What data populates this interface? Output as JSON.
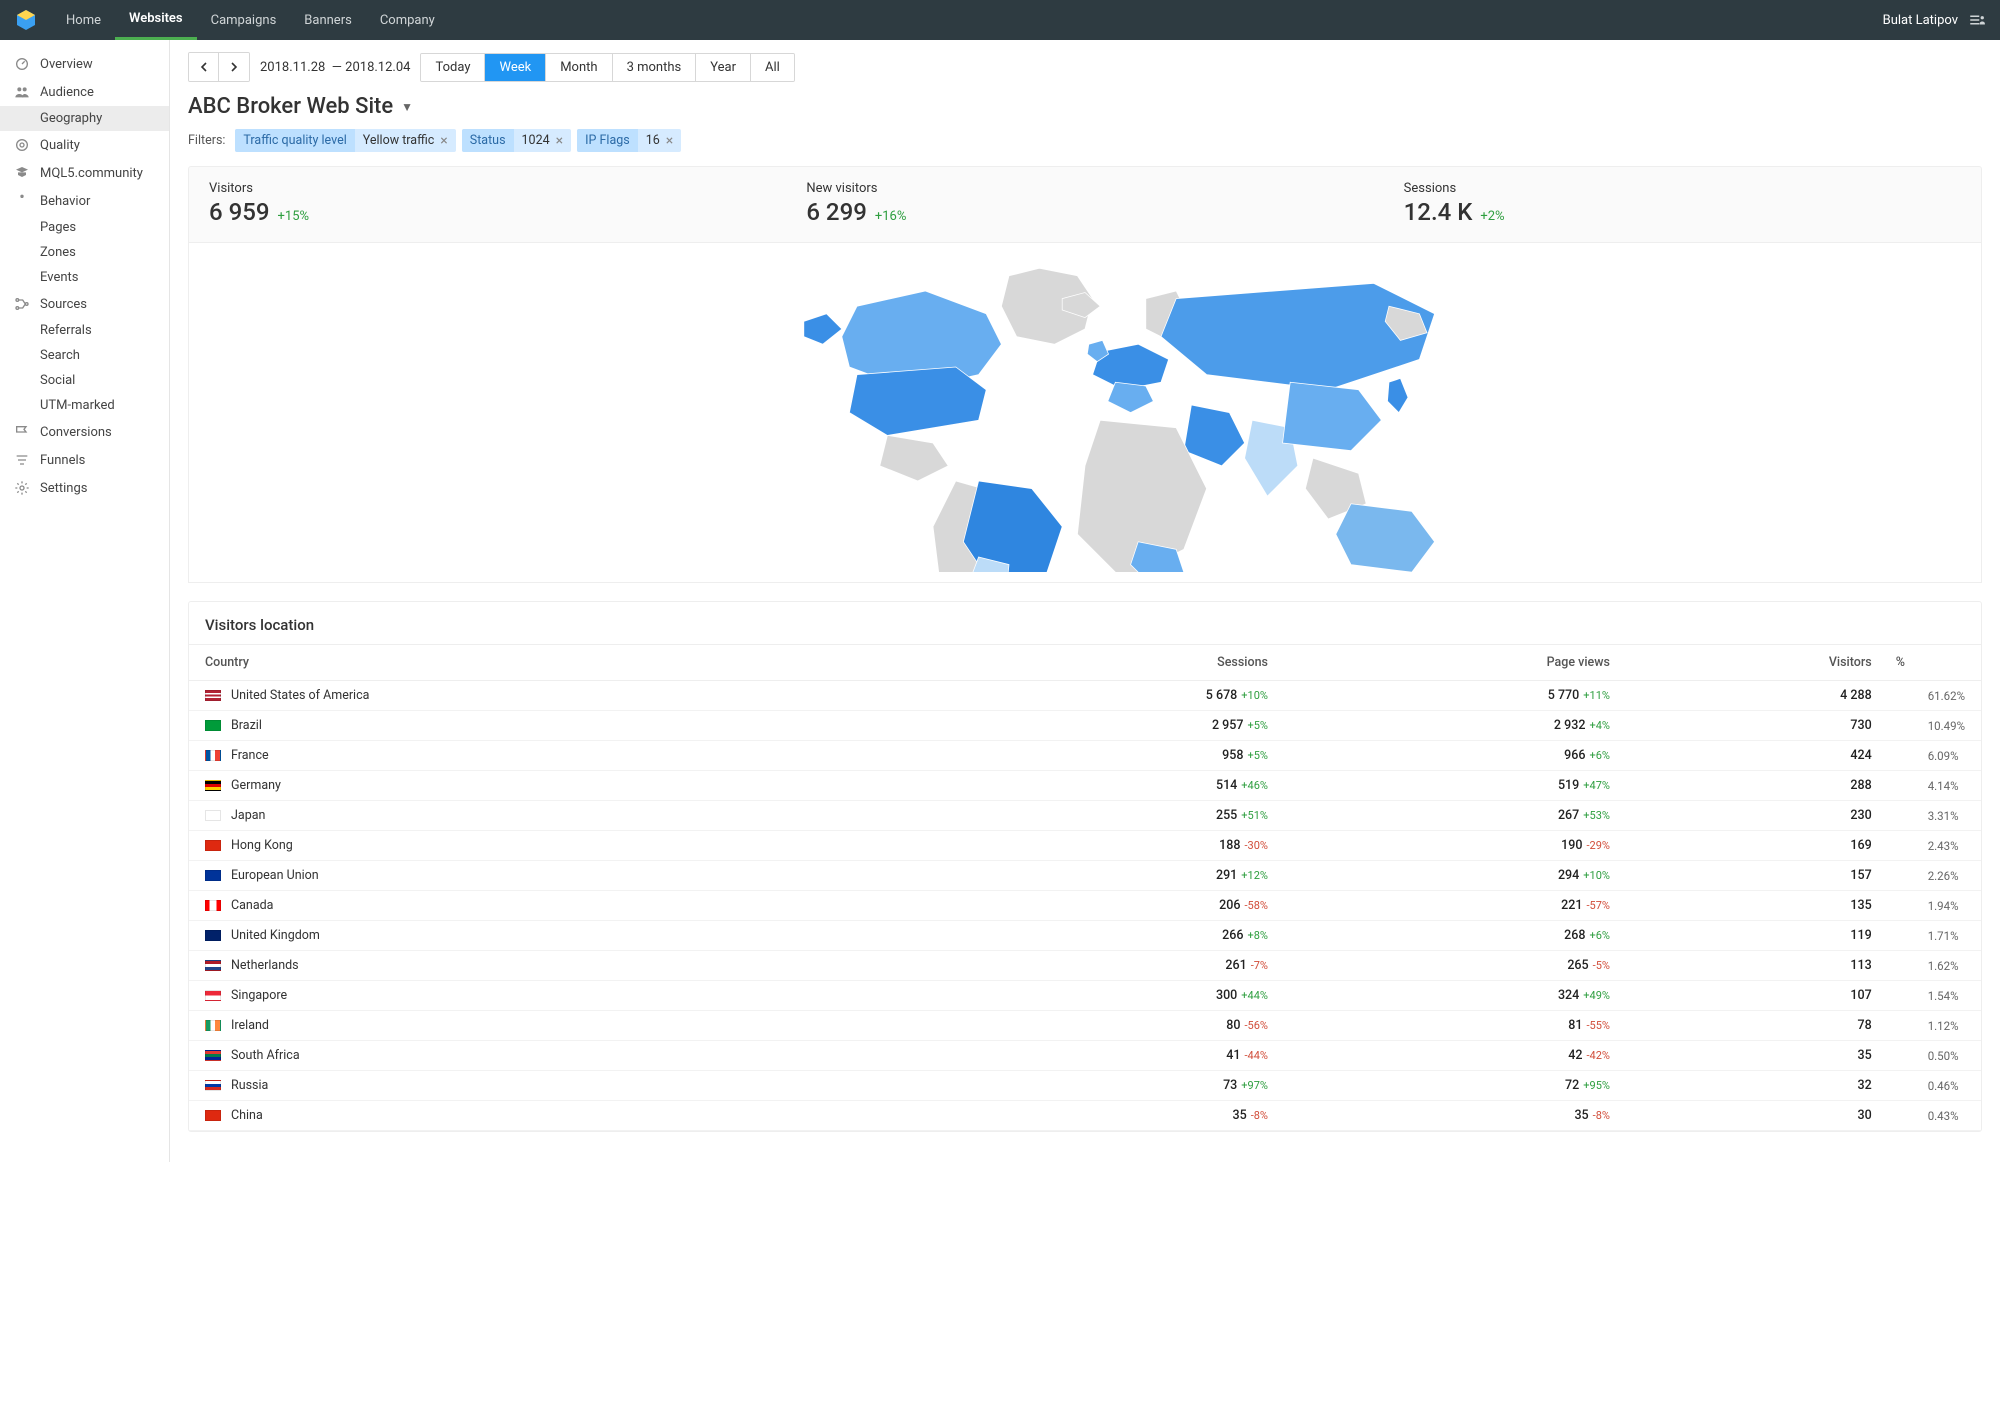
{
  "nav": {
    "items": [
      "Home",
      "Websites",
      "Campaigns",
      "Banners",
      "Company"
    ],
    "active": 1,
    "user": "Bulat Latipov"
  },
  "sidebar": {
    "items": [
      {
        "label": "Overview",
        "icon": "overview"
      },
      {
        "label": "Audience",
        "icon": "audience",
        "subs": [
          {
            "label": "Geography",
            "active": true
          }
        ]
      },
      {
        "label": "Quality",
        "icon": "quality"
      },
      {
        "label": "MQL5.community",
        "icon": "community"
      },
      {
        "label": "Behavior",
        "icon": "behavior",
        "subs": [
          {
            "label": "Pages"
          },
          {
            "label": "Zones"
          },
          {
            "label": "Events"
          }
        ]
      },
      {
        "label": "Sources",
        "icon": "sources",
        "subs": [
          {
            "label": "Referrals"
          },
          {
            "label": "Search"
          },
          {
            "label": "Social"
          },
          {
            "label": "UTM-marked"
          }
        ]
      },
      {
        "label": "Conversions",
        "icon": "conversions"
      },
      {
        "label": "Funnels",
        "icon": "funnels"
      },
      {
        "label": "Settings",
        "icon": "settings"
      }
    ]
  },
  "toolbar": {
    "date_from": "2018.11.28",
    "date_to": "2018.12.04",
    "separator": "—",
    "ranges": [
      "Today",
      "Week",
      "Month",
      "3 months",
      "Year",
      "All"
    ],
    "active_range": 1
  },
  "page": {
    "title": "ABC Broker Web Site"
  },
  "filters": {
    "label": "Filters:",
    "chips": [
      {
        "key": "Traffic quality level",
        "val": "Yellow traffic",
        "closable": true
      },
      {
        "key": "Status",
        "val": "1024",
        "closable": true
      },
      {
        "key": "IP Flags",
        "val": "16",
        "closable": true
      }
    ]
  },
  "stats": [
    {
      "label": "Visitors",
      "value": "6 959",
      "delta": "+15%",
      "dir": "pos"
    },
    {
      "label": "New visitors",
      "value": "6 299",
      "delta": "+16%",
      "dir": "pos"
    },
    {
      "label": "Sessions",
      "value": "12.4 K",
      "delta": "+2%",
      "dir": "pos"
    }
  ],
  "table": {
    "title": "Visitors location",
    "columns": [
      "Country",
      "Sessions",
      "Page views",
      "Visitors",
      "%"
    ],
    "rows": [
      {
        "flag": "us",
        "country": "United States of America",
        "sessions": "5 678",
        "sessions_d": "+10%",
        "sd": "pos",
        "views": "5 770",
        "views_d": "+11%",
        "vd": "pos",
        "visitors": "4 288",
        "pct": "61.62%",
        "bar": 61.62
      },
      {
        "flag": "br",
        "country": "Brazil",
        "sessions": "2 957",
        "sessions_d": "+5%",
        "sd": "pos",
        "views": "2 932",
        "views_d": "+4%",
        "vd": "pos",
        "visitors": "730",
        "pct": "10.49%",
        "bar": 10.49
      },
      {
        "flag": "fr",
        "country": "France",
        "sessions": "958",
        "sessions_d": "+5%",
        "sd": "pos",
        "views": "966",
        "views_d": "+6%",
        "vd": "pos",
        "visitors": "424",
        "pct": "6.09%",
        "bar": 6.09
      },
      {
        "flag": "de",
        "country": "Germany",
        "sessions": "514",
        "sessions_d": "+46%",
        "sd": "pos",
        "views": "519",
        "views_d": "+47%",
        "vd": "pos",
        "visitors": "288",
        "pct": "4.14%",
        "bar": 4.14
      },
      {
        "flag": "jp",
        "country": "Japan",
        "sessions": "255",
        "sessions_d": "+51%",
        "sd": "pos",
        "views": "267",
        "views_d": "+53%",
        "vd": "pos",
        "visitors": "230",
        "pct": "3.31%",
        "bar": 3.31
      },
      {
        "flag": "hk",
        "country": "Hong Kong",
        "sessions": "188",
        "sessions_d": "-30%",
        "sd": "neg",
        "views": "190",
        "views_d": "-29%",
        "vd": "neg",
        "visitors": "169",
        "pct": "2.43%",
        "bar": 2.43
      },
      {
        "flag": "eu",
        "country": "European Union",
        "sessions": "291",
        "sessions_d": "+12%",
        "sd": "pos",
        "views": "294",
        "views_d": "+10%",
        "vd": "pos",
        "visitors": "157",
        "pct": "2.26%",
        "bar": 2.26
      },
      {
        "flag": "ca",
        "country": "Canada",
        "sessions": "206",
        "sessions_d": "-58%",
        "sd": "neg",
        "views": "221",
        "views_d": "-57%",
        "vd": "neg",
        "visitors": "135",
        "pct": "1.94%",
        "bar": 1.94
      },
      {
        "flag": "gb",
        "country": "United Kingdom",
        "sessions": "266",
        "sessions_d": "+8%",
        "sd": "pos",
        "views": "268",
        "views_d": "+6%",
        "vd": "pos",
        "visitors": "119",
        "pct": "1.71%",
        "bar": 1.71
      },
      {
        "flag": "nl",
        "country": "Netherlands",
        "sessions": "261",
        "sessions_d": "-7%",
        "sd": "neg",
        "views": "265",
        "views_d": "-5%",
        "vd": "neg",
        "visitors": "113",
        "pct": "1.62%",
        "bar": 1.62
      },
      {
        "flag": "sg",
        "country": "Singapore",
        "sessions": "300",
        "sessions_d": "+44%",
        "sd": "pos",
        "views": "324",
        "views_d": "+49%",
        "vd": "pos",
        "visitors": "107",
        "pct": "1.54%",
        "bar": 1.54
      },
      {
        "flag": "ie",
        "country": "Ireland",
        "sessions": "80",
        "sessions_d": "-56%",
        "sd": "neg",
        "views": "81",
        "views_d": "-55%",
        "vd": "neg",
        "visitors": "78",
        "pct": "1.12%",
        "bar": 1.12
      },
      {
        "flag": "za",
        "country": "South Africa",
        "sessions": "41",
        "sessions_d": "-44%",
        "sd": "neg",
        "views": "42",
        "views_d": "-42%",
        "vd": "neg",
        "visitors": "35",
        "pct": "0.50%",
        "bar": 0.5
      },
      {
        "flag": "ru",
        "country": "Russia",
        "sessions": "73",
        "sessions_d": "+97%",
        "sd": "pos",
        "views": "72",
        "views_d": "+95%",
        "vd": "pos",
        "visitors": "32",
        "pct": "0.46%",
        "bar": 0.46
      },
      {
        "flag": "cn",
        "country": "China",
        "sessions": "35",
        "sessions_d": "-8%",
        "sd": "neg",
        "views": "35",
        "views_d": "-8%",
        "vd": "neg",
        "visitors": "30",
        "pct": "0.43%",
        "bar": 0.43
      }
    ]
  },
  "flags": {
    "us": "background:linear-gradient(#b22234 0 20%,#fff 20% 40%,#b22234 40% 60%,#fff 60% 80%,#b22234 80% 100%);position:relative;",
    "br": "background:#009b3a;",
    "fr": "background:linear-gradient(90deg,#0055a4 0 33%,#fff 33% 66%,#ef4135 66% 100%);",
    "de": "background:linear-gradient(#000 0 33%,#dd0000 33% 66%,#ffce00 66% 100%);",
    "jp": "background:#fff;",
    "hk": "background:#de2910;",
    "eu": "background:#003399;",
    "ca": "background:linear-gradient(90deg,#ff0000 0 25%,#fff 25% 75%,#ff0000 75% 100%);",
    "gb": "background:#012169;",
    "nl": "background:linear-gradient(#ae1c28 0 33%,#fff 33% 66%,#21468b 66% 100%);",
    "sg": "background:linear-gradient(#ed2939 0 50%,#fff 50% 100%);",
    "ie": "background:linear-gradient(90deg,#169b62 0 33%,#fff 33% 66%,#ff883e 66% 100%);",
    "za": "background:linear-gradient(#de3831 0 33%,#007a4d 33% 66%,#002395 66% 100%);",
    "ru": "background:linear-gradient(#fff 0 33%,#0039a6 33% 66%,#d52b1e 66% 100%);",
    "cn": "background:#de2910;"
  }
}
